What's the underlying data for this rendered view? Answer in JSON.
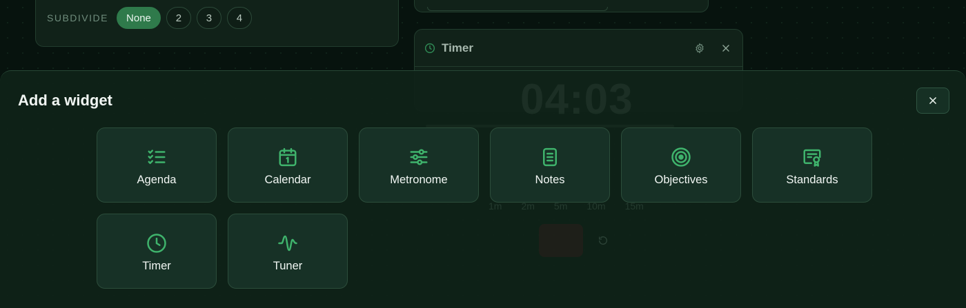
{
  "background": {
    "metronome_card": {
      "subdivide_label": "SUBDIVIDE",
      "subdivide_options": [
        "None",
        "2",
        "3",
        "4"
      ],
      "selected": "None"
    },
    "timer_card": {
      "title": "Timer",
      "icons": [
        "clock-icon",
        "gear-icon",
        "close-icon"
      ],
      "display": "04:03",
      "presets": [
        "1m",
        "2m",
        "5m",
        "10m",
        "15m"
      ]
    }
  },
  "modal": {
    "title": "Add a widget",
    "close_icon": "close-icon",
    "widgets": [
      {
        "label": "Agenda",
        "icon": "checklist-icon"
      },
      {
        "label": "Calendar",
        "icon": "calendar-icon"
      },
      {
        "label": "Metronome",
        "icon": "sliders-icon"
      },
      {
        "label": "Notes",
        "icon": "document-icon"
      },
      {
        "label": "Objectives",
        "icon": "target-icon"
      },
      {
        "label": "Standards",
        "icon": "certificate-icon"
      },
      {
        "label": "Timer",
        "icon": "clock-icon"
      },
      {
        "label": "Tuner",
        "icon": "waveform-icon"
      }
    ]
  },
  "colors": {
    "accent": "#3fb36c",
    "active_pill": "#2f7a4b",
    "tile_bg": "#173126",
    "modal_bg": "#0f2218"
  }
}
